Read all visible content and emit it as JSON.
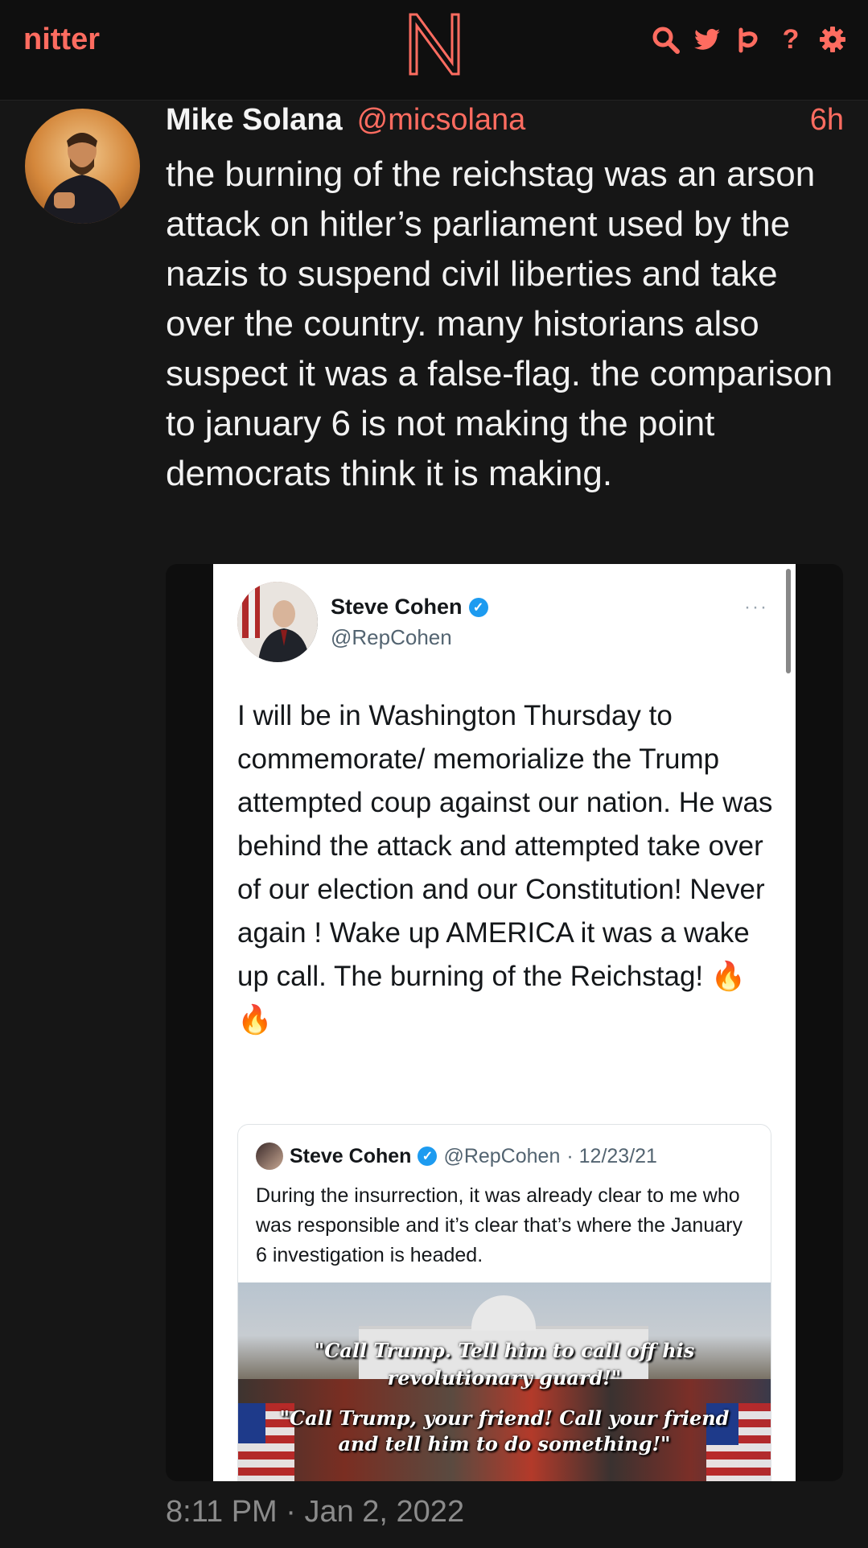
{
  "nav": {
    "brand": "nitter",
    "icons": [
      "search-icon",
      "twitter-bird-icon",
      "rss-icon",
      "help-icon",
      "gear-icon"
    ],
    "help_glyph": "?"
  },
  "tweet": {
    "fullname": "Mike Solana",
    "username": "@micsolana",
    "time": "6h",
    "text": "the burning of the reichstag was an arson attack on hitler’s parliament used by the nazis to suspend civil liberties and take over the country. many historians also suspect it was a false-flag. the comparison to january 6 is not making the point democrats think it is making.",
    "published": "8:11 PM · Jan 2, 2022"
  },
  "embedded": {
    "name": "Steve Cohen",
    "handle": "@RepCohen",
    "more": "···",
    "verified_glyph": "✓",
    "text": "I will be in Washington Thursday to commemorate/ memorialize the Trump attempted coup against our nation. He was behind the attack and attempted take over of our election and our Constitution! Never again ! Wake up AMERICA it was a wake up call. The burning of the Reichstag! 🔥 🔥",
    "quote": {
      "name": "Steve Cohen",
      "handle": "@RepCohen",
      "date": "· 12/23/21",
      "text": "During the insurrection, it was already clear to me who was responsible and it’s clear that’s where the January 6 investigation is headed.",
      "captions": [
        "\"Call Trump. Tell him to call off his",
        "revolutionary guard!\"",
        "\"Call Trump, your friend! Call your friend",
        "and tell him to do something!\""
      ]
    }
  },
  "colors": {
    "accent": "#ff6c60",
    "background": "#161616",
    "navbar": "#0f0f0f",
    "verified": "#1d9bf0"
  }
}
